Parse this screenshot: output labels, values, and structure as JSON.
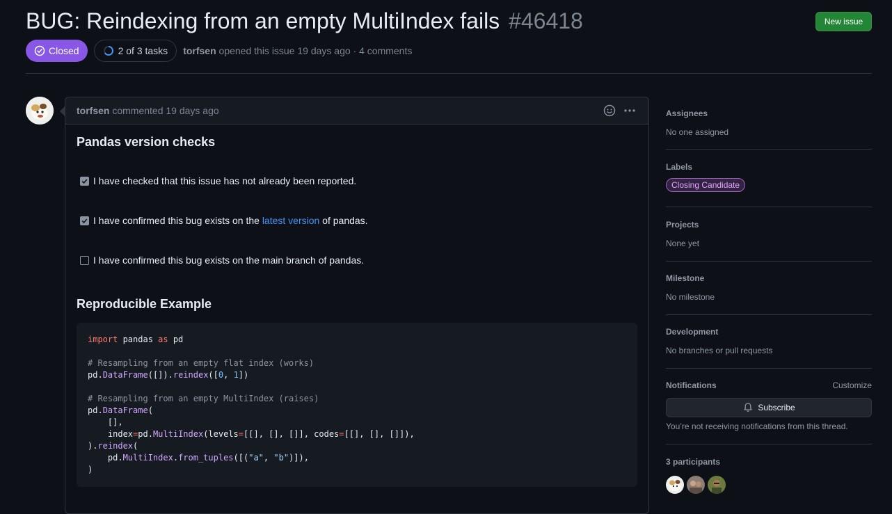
{
  "issue": {
    "title": "BUG: Reindexing from an empty MultiIndex fails",
    "number": "#46418",
    "new_issue_label": "New issue",
    "state": "Closed",
    "tasks": "2 of 3 tasks",
    "author": "torfsen",
    "opened_text": "opened this issue 19 days ago · 4 comments"
  },
  "comment": {
    "author": "torfsen",
    "timestamp": "commented 19 days ago",
    "heading1": "Pandas version checks",
    "tasks": [
      {
        "checked": true,
        "text": "I have checked that this issue has not already been reported."
      },
      {
        "checked": true,
        "text_before": "I have confirmed this bug exists on the ",
        "link": "latest version",
        "text_after": " of pandas."
      },
      {
        "checked": false,
        "text": "I have confirmed this bug exists on the main branch of pandas."
      }
    ],
    "heading2": "Reproducible Example",
    "code": [
      "import pandas as pd",
      "",
      "# Resampling from an empty flat index (works)",
      "pd.DataFrame([]).reindex([0, 1])",
      "",
      "# Resampling from an empty MultiIndex (raises)",
      "pd.DataFrame(",
      "    [],",
      "    index=pd.MultiIndex(levels=[[], [], []], codes=[[], [], []]),",
      ").reindex(",
      "    pd.MultiIndex.from_tuples([(\"a\", \"b\")]),",
      ")"
    ]
  },
  "sidebar": {
    "assignees": {
      "title": "Assignees",
      "value": "No one assigned"
    },
    "labels": {
      "title": "Labels",
      "items": [
        "Closing Candidate"
      ]
    },
    "projects": {
      "title": "Projects",
      "value": "None yet"
    },
    "milestone": {
      "title": "Milestone",
      "value": "No milestone"
    },
    "development": {
      "title": "Development",
      "value": "No branches or pull requests"
    },
    "notifications": {
      "title": "Notifications",
      "customize": "Customize",
      "subscribe": "Subscribe",
      "status": "You’re not receiving notifications from this thread."
    },
    "participants": {
      "title": "3 participants"
    }
  },
  "colors": {
    "background": "#0d1117",
    "closed_badge": "#8957e5",
    "new_issue_button": "#238636",
    "link": "#4493f8",
    "label_border": "#a35dc2"
  }
}
